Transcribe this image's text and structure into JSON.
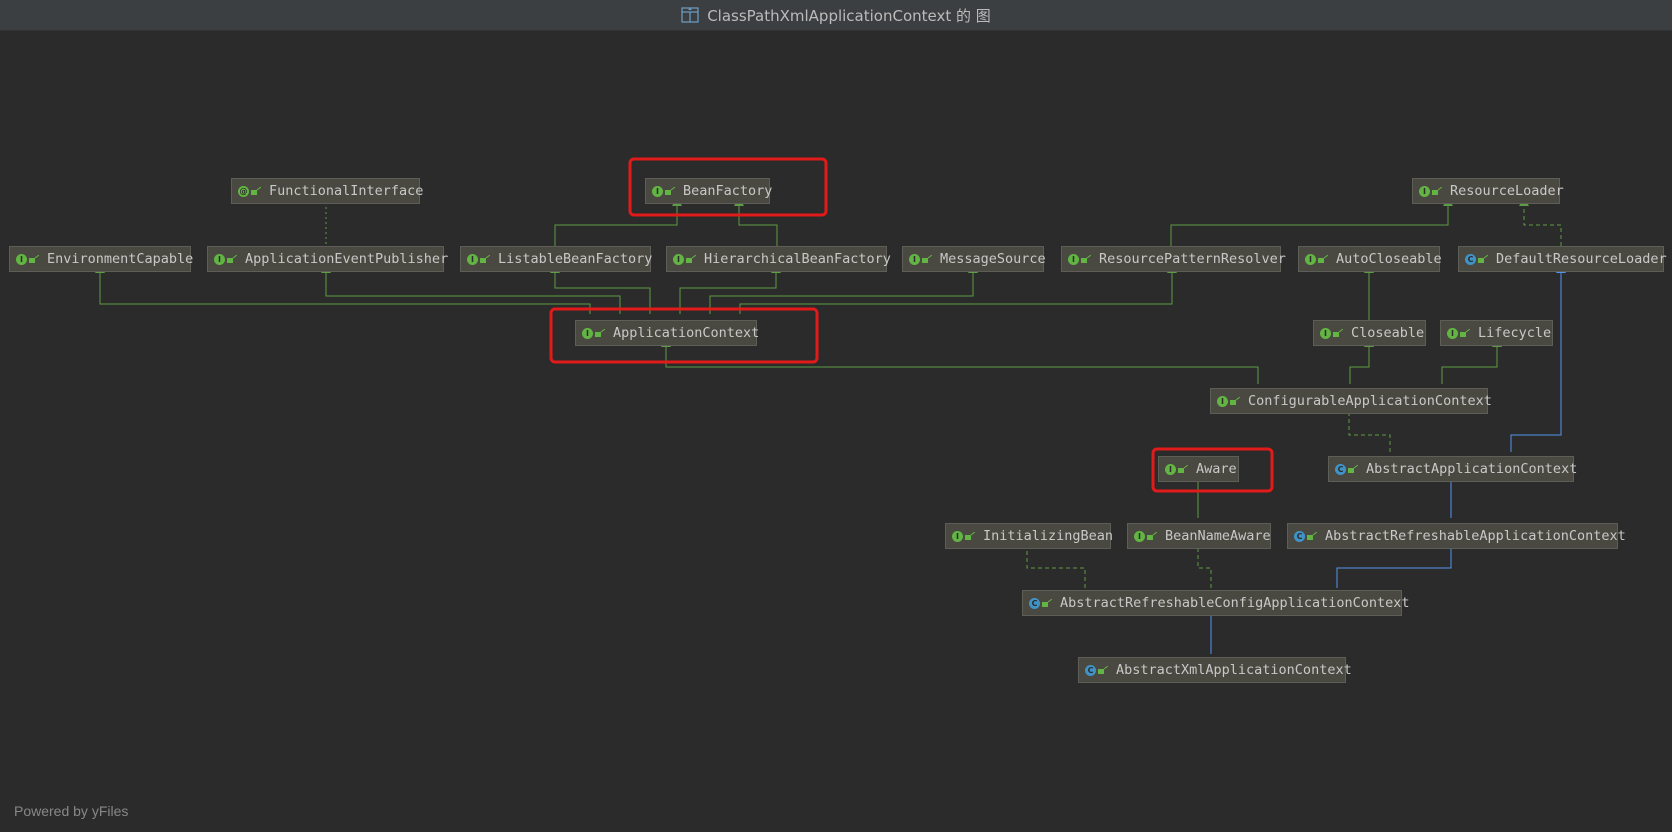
{
  "window": {
    "title": "ClassPathXmlApplicationContext 的 图",
    "title_icon": "class-diagram-icon"
  },
  "colors": {
    "background": "#2b2b2b",
    "node_fill": "#4a4941",
    "interface_badge": "#62b543",
    "class_badge": "#3f93c7",
    "interface_edge": "#5e9c45",
    "class_edge": "#5394ec",
    "highlight_box": "#e11a1a"
  },
  "diagram": {
    "nodes": [
      {
        "id": "functional_interface",
        "name": "FunctionalInterface",
        "kind": "annotation"
      },
      {
        "id": "bean_factory",
        "name": "BeanFactory",
        "kind": "interface",
        "highlighted": true
      },
      {
        "id": "resource_loader",
        "name": "ResourceLoader",
        "kind": "interface"
      },
      {
        "id": "environment_capable",
        "name": "EnvironmentCapable",
        "kind": "interface"
      },
      {
        "id": "application_event_publisher",
        "name": "ApplicationEventPublisher",
        "kind": "interface"
      },
      {
        "id": "listable_bean_factory",
        "name": "ListableBeanFactory",
        "kind": "interface"
      },
      {
        "id": "hierarchical_bean_factory",
        "name": "HierarchicalBeanFactory",
        "kind": "interface"
      },
      {
        "id": "message_source",
        "name": "MessageSource",
        "kind": "interface"
      },
      {
        "id": "resource_pattern_resolver",
        "name": "ResourcePatternResolver",
        "kind": "interface"
      },
      {
        "id": "auto_closeable",
        "name": "AutoCloseable",
        "kind": "interface"
      },
      {
        "id": "default_resource_loader",
        "name": "DefaultResourceLoader",
        "kind": "class"
      },
      {
        "id": "application_context",
        "name": "ApplicationContext",
        "kind": "interface",
        "highlighted": true
      },
      {
        "id": "closeable",
        "name": "Closeable",
        "kind": "interface"
      },
      {
        "id": "lifecycle",
        "name": "Lifecycle",
        "kind": "interface"
      },
      {
        "id": "configurable_application_context",
        "name": "ConfigurableApplicationContext",
        "kind": "interface"
      },
      {
        "id": "aware",
        "name": "Aware",
        "kind": "interface",
        "highlighted": true
      },
      {
        "id": "abstract_application_context",
        "name": "AbstractApplicationContext",
        "kind": "abstract-class"
      },
      {
        "id": "initializing_bean",
        "name": "InitializingBean",
        "kind": "interface"
      },
      {
        "id": "bean_name_aware",
        "name": "BeanNameAware",
        "kind": "interface"
      },
      {
        "id": "abstract_refreshable_application_context",
        "name": "AbstractRefreshableApplicationContext",
        "kind": "abstract-class"
      },
      {
        "id": "abstract_refreshable_config_application_context",
        "name": "AbstractRefreshableConfigApplicationContext",
        "kind": "abstract-class"
      },
      {
        "id": "abstract_xml_application_context",
        "name": "AbstractXmlApplicationContext",
        "kind": "abstract-class"
      }
    ],
    "edges": [
      {
        "from": "listable_bean_factory",
        "to": "bean_factory",
        "type": "extends-interface"
      },
      {
        "from": "hierarchical_bean_factory",
        "to": "bean_factory",
        "type": "extends-interface"
      },
      {
        "from": "resource_pattern_resolver",
        "to": "resource_loader",
        "type": "extends-interface"
      },
      {
        "from": "default_resource_loader",
        "to": "resource_loader",
        "type": "implements"
      },
      {
        "from": "application_event_publisher",
        "to": "functional_interface",
        "type": "annotated"
      },
      {
        "from": "application_context",
        "to": "environment_capable",
        "type": "extends-interface"
      },
      {
        "from": "application_context",
        "to": "application_event_publisher",
        "type": "extends-interface"
      },
      {
        "from": "application_context",
        "to": "listable_bean_factory",
        "type": "extends-interface"
      },
      {
        "from": "application_context",
        "to": "hierarchical_bean_factory",
        "type": "extends-interface"
      },
      {
        "from": "application_context",
        "to": "message_source",
        "type": "extends-interface"
      },
      {
        "from": "application_context",
        "to": "resource_pattern_resolver",
        "type": "extends-interface"
      },
      {
        "from": "closeable",
        "to": "auto_closeable",
        "type": "extends-interface"
      },
      {
        "from": "configurable_application_context",
        "to": "application_context",
        "type": "extends-interface"
      },
      {
        "from": "configurable_application_context",
        "to": "closeable",
        "type": "extends-interface"
      },
      {
        "from": "configurable_application_context",
        "to": "lifecycle",
        "type": "extends-interface"
      },
      {
        "from": "abstract_application_context",
        "to": "configurable_application_context",
        "type": "implements"
      },
      {
        "from": "abstract_application_context",
        "to": "default_resource_loader",
        "type": "extends-class"
      },
      {
        "from": "bean_name_aware",
        "to": "aware",
        "type": "extends-interface"
      },
      {
        "from": "abstract_refreshable_application_context",
        "to": "abstract_application_context",
        "type": "extends-class"
      },
      {
        "from": "abstract_refreshable_config_application_context",
        "to": "initializing_bean",
        "type": "implements"
      },
      {
        "from": "abstract_refreshable_config_application_context",
        "to": "bean_name_aware",
        "type": "implements"
      },
      {
        "from": "abstract_refreshable_config_application_context",
        "to": "abstract_refreshable_application_context",
        "type": "extends-class"
      },
      {
        "from": "abstract_xml_application_context",
        "to": "abstract_refreshable_config_application_context",
        "type": "extends-class"
      }
    ]
  },
  "footer": {
    "powered_by": "Powered by yFiles"
  }
}
